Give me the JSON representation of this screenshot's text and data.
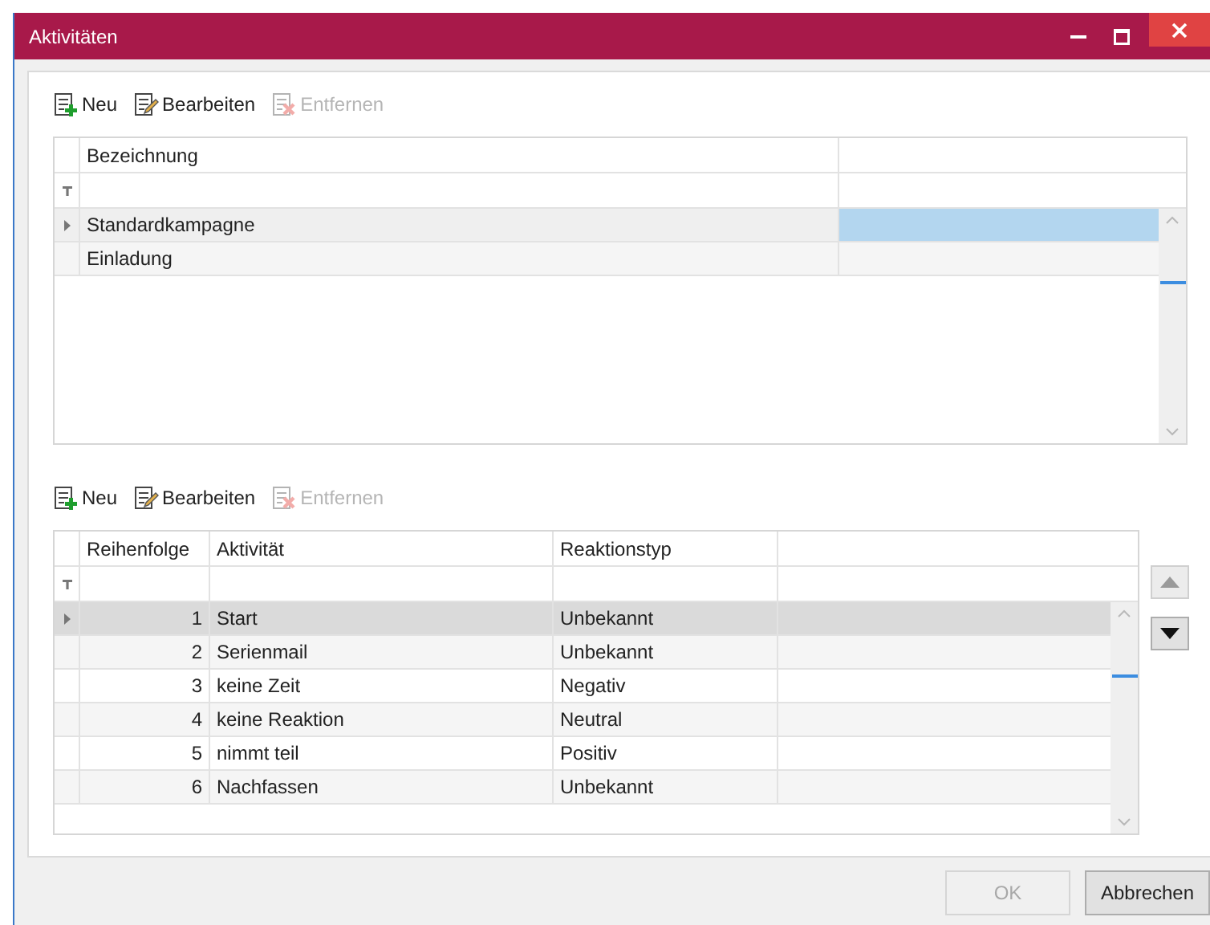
{
  "window": {
    "title": "Aktivitäten"
  },
  "campaigns": {
    "toolbar": [
      {
        "kind": "new",
        "label": "Neu",
        "disabled": false
      },
      {
        "kind": "edit",
        "label": "Bearbeiten",
        "disabled": false
      },
      {
        "kind": "delete",
        "label": "Entfernen",
        "disabled": true
      }
    ],
    "columns": [
      "Bezeichnung"
    ],
    "rows": [
      {
        "cells": [
          "Standardkampagne"
        ],
        "selected": true
      },
      {
        "cells": [
          "Einladung"
        ],
        "selected": false
      }
    ]
  },
  "activities": {
    "toolbar": [
      {
        "kind": "new",
        "label": "Neu",
        "disabled": false
      },
      {
        "kind": "edit",
        "label": "Bearbeiten",
        "disabled": false
      },
      {
        "kind": "delete",
        "label": "Entfernen",
        "disabled": true
      }
    ],
    "columns": [
      "Reihenfolge",
      "Aktivität",
      "Reaktionstyp"
    ],
    "rows": [
      {
        "cells": [
          "1",
          "Start",
          "Unbekannt"
        ],
        "selected": true
      },
      {
        "cells": [
          "2",
          "Serienmail",
          "Unbekannt"
        ],
        "selected": false
      },
      {
        "cells": [
          "3",
          "keine Zeit",
          "Negativ"
        ],
        "selected": false
      },
      {
        "cells": [
          "4",
          "keine Reaktion",
          "Neutral"
        ],
        "selected": false
      },
      {
        "cells": [
          "5",
          "nimmt teil",
          "Positiv"
        ],
        "selected": false
      },
      {
        "cells": [
          "6",
          "Nachfassen",
          "Unbekannt"
        ],
        "selected": false
      }
    ],
    "move_buttons": [
      {
        "kind": "up",
        "disabled": true
      },
      {
        "kind": "down",
        "disabled": false
      }
    ]
  },
  "buttons": [
    {
      "label": "OK",
      "disabled": true
    },
    {
      "label": "Abbrechen",
      "disabled": false
    }
  ]
}
